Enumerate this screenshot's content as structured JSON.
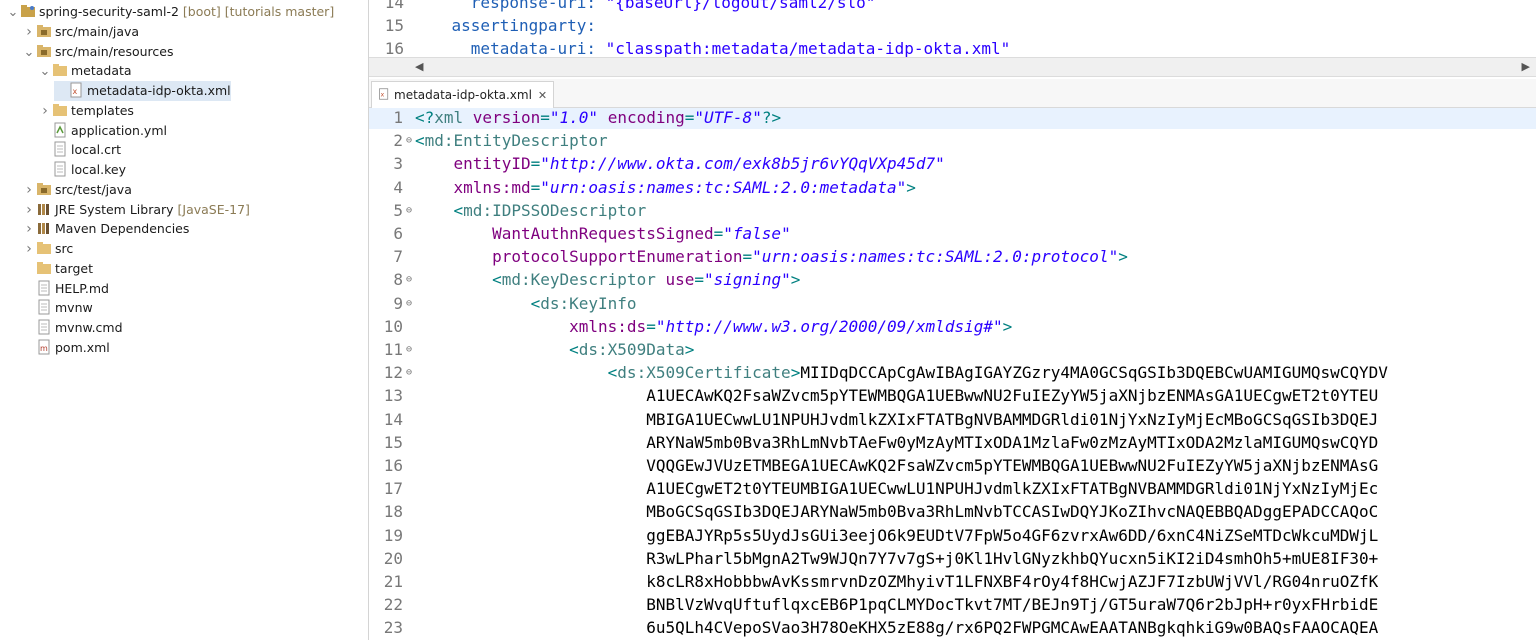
{
  "explorer": {
    "items": [
      {
        "label": "spring-security-saml-2",
        "deco": " [boot] [tutorials master]",
        "indent": 0,
        "twisty": "v",
        "icon": "project-icon"
      },
      {
        "label": "src/main/java",
        "deco": "",
        "indent": 1,
        "twisty": ">",
        "icon": "source-folder-icon"
      },
      {
        "label": "src/main/resources",
        "deco": "",
        "indent": 1,
        "twisty": "v",
        "icon": "source-folder-icon"
      },
      {
        "label": "metadata",
        "deco": "",
        "indent": 2,
        "twisty": "v",
        "icon": "folder-icon"
      },
      {
        "label": "metadata-idp-okta.xml",
        "deco": "",
        "indent": 3,
        "twisty": "",
        "icon": "xml-file-icon"
      },
      {
        "label": "templates",
        "deco": "",
        "indent": 2,
        "twisty": ">",
        "icon": "folder-icon"
      },
      {
        "label": "application.yml",
        "deco": "",
        "indent": 2,
        "twisty": "",
        "icon": "yml-file-icon"
      },
      {
        "label": "local.crt",
        "deco": "",
        "indent": 2,
        "twisty": "",
        "icon": "file-icon"
      },
      {
        "label": "local.key",
        "deco": "",
        "indent": 2,
        "twisty": "",
        "icon": "file-icon"
      },
      {
        "label": "src/test/java",
        "deco": "",
        "indent": 1,
        "twisty": ">",
        "icon": "source-folder-icon"
      },
      {
        "label": "JRE System Library",
        "deco": " [JavaSE-17]",
        "indent": 1,
        "twisty": ">",
        "icon": "library-icon"
      },
      {
        "label": "Maven Dependencies",
        "deco": "",
        "indent": 1,
        "twisty": ">",
        "icon": "library-icon"
      },
      {
        "label": "src",
        "deco": "",
        "indent": 1,
        "twisty": ">",
        "icon": "folder-icon"
      },
      {
        "label": "target",
        "deco": "",
        "indent": 1,
        "twisty": "",
        "icon": "folder-icon"
      },
      {
        "label": "HELP.md",
        "deco": "",
        "indent": 1,
        "twisty": "",
        "icon": "file-icon"
      },
      {
        "label": "mvnw",
        "deco": "",
        "indent": 1,
        "twisty": "",
        "icon": "file-icon"
      },
      {
        "label": "mvnw.cmd",
        "deco": "",
        "indent": 1,
        "twisty": "",
        "icon": "file-icon"
      },
      {
        "label": "pom.xml",
        "deco": "",
        "indent": 1,
        "twisty": "",
        "icon": "maven-file-icon"
      }
    ]
  },
  "top_editor": {
    "lines": [
      {
        "num": "14",
        "text": "      response-uri: \"{baseUrl}/logout/saml2/slo\""
      },
      {
        "num": "15",
        "text": "    assertingparty:"
      },
      {
        "num": "16",
        "text": "      metadata-uri: \"classpath:metadata/metadata-idp-okta.xml\""
      }
    ]
  },
  "tab": {
    "label": "metadata-idp-okta.xml",
    "close": "✕"
  },
  "editor": {
    "lines": [
      {
        "num": "1",
        "fold": "",
        "parts": [
          [
            "pun",
            "<?"
          ],
          [
            "tag",
            "xml "
          ],
          [
            "attr",
            "version"
          ],
          [
            "pun",
            "="
          ],
          [
            "val",
            "\"1.0\""
          ],
          [
            "text",
            " "
          ],
          [
            "attr",
            "encoding"
          ],
          [
            "pun",
            "="
          ],
          [
            "val",
            "\"UTF-8\""
          ],
          [
            "pun",
            "?>"
          ]
        ]
      },
      {
        "num": "2",
        "fold": "⊖",
        "parts": [
          [
            "pun",
            "<"
          ],
          [
            "tag",
            "md:EntityDescriptor"
          ]
        ]
      },
      {
        "num": "3",
        "fold": "",
        "parts": [
          [
            "text",
            "    "
          ],
          [
            "attr",
            "entityID"
          ],
          [
            "pun",
            "="
          ],
          [
            "val",
            "\"http://www.okta.com/exk8b5jr6vYQqVXp45d7\""
          ]
        ]
      },
      {
        "num": "4",
        "fold": "",
        "parts": [
          [
            "text",
            "    "
          ],
          [
            "attr",
            "xmlns:md"
          ],
          [
            "pun",
            "="
          ],
          [
            "val",
            "\"urn:oasis:names:tc:SAML:2.0:metadata\""
          ],
          [
            "pun",
            ">"
          ]
        ]
      },
      {
        "num": "5",
        "fold": "⊖",
        "parts": [
          [
            "text",
            "    "
          ],
          [
            "pun",
            "<"
          ],
          [
            "tag",
            "md:IDPSSODescriptor"
          ]
        ]
      },
      {
        "num": "6",
        "fold": "",
        "parts": [
          [
            "text",
            "        "
          ],
          [
            "attr",
            "WantAuthnRequestsSigned"
          ],
          [
            "pun",
            "="
          ],
          [
            "val",
            "\"false\""
          ]
        ]
      },
      {
        "num": "7",
        "fold": "",
        "parts": [
          [
            "text",
            "        "
          ],
          [
            "attr",
            "protocolSupportEnumeration"
          ],
          [
            "pun",
            "="
          ],
          [
            "val",
            "\"urn:oasis:names:tc:SAML:2.0:protocol\""
          ],
          [
            "pun",
            ">"
          ]
        ]
      },
      {
        "num": "8",
        "fold": "⊖",
        "parts": [
          [
            "text",
            "        "
          ],
          [
            "pun",
            "<"
          ],
          [
            "tag",
            "md:KeyDescriptor "
          ],
          [
            "attr",
            "use"
          ],
          [
            "pun",
            "="
          ],
          [
            "val",
            "\"signing\""
          ],
          [
            "pun",
            ">"
          ]
        ]
      },
      {
        "num": "9",
        "fold": "⊖",
        "parts": [
          [
            "text",
            "            "
          ],
          [
            "pun",
            "<"
          ],
          [
            "tag",
            "ds:KeyInfo"
          ]
        ]
      },
      {
        "num": "10",
        "fold": "",
        "parts": [
          [
            "text",
            "                "
          ],
          [
            "attr",
            "xmlns:ds"
          ],
          [
            "pun",
            "="
          ],
          [
            "val",
            "\"http://www.w3.org/2000/09/xmldsig#\""
          ],
          [
            "pun",
            ">"
          ]
        ]
      },
      {
        "num": "11",
        "fold": "⊖",
        "parts": [
          [
            "text",
            "                "
          ],
          [
            "pun",
            "<"
          ],
          [
            "tag",
            "ds:X509Data"
          ],
          [
            "pun",
            ">"
          ]
        ]
      },
      {
        "num": "12",
        "fold": "⊖",
        "parts": [
          [
            "text",
            "                    "
          ],
          [
            "pun",
            "<"
          ],
          [
            "tag",
            "ds:X509Certificate"
          ],
          [
            "pun",
            ">"
          ],
          [
            "text",
            "MIIDqDCCApCgAwIBAgIGAYZGzry4MA0GCSqGSIb3DQEBCwUAMIGUMQswCQYDV"
          ]
        ]
      },
      {
        "num": "13",
        "fold": "",
        "parts": [
          [
            "text",
            "                        A1UECAwKQ2FsaWZvcm5pYTEWMBQGA1UEBwwNU2FuIEZyYW5jaXNjbzENMAsGA1UECgwET2t0YTEU"
          ]
        ]
      },
      {
        "num": "14",
        "fold": "",
        "parts": [
          [
            "text",
            "                        MBIGA1UECwwLU1NPUHJvdmlkZXIxFTATBgNVBAMMDGRldi01NjYxNzIyMjEcMBoGCSqGSIb3DQEJ"
          ]
        ]
      },
      {
        "num": "15",
        "fold": "",
        "parts": [
          [
            "text",
            "                        ARYNaW5mb0Bva3RhLmNvbTAeFw0yMzAyMTIxODA1MzlaFw0zMzAyMTIxODA2MzlaMIGUMQswCQYD"
          ]
        ]
      },
      {
        "num": "16",
        "fold": "",
        "parts": [
          [
            "text",
            "                        VQQGEwJVUzETMBEGA1UECAwKQ2FsaWZvcm5pYTEWMBQGA1UEBwwNU2FuIEZyYW5jaXNjbzENMAsG"
          ]
        ]
      },
      {
        "num": "17",
        "fold": "",
        "parts": [
          [
            "text",
            "                        A1UECgwET2t0YTEUMBIGA1UECwwLU1NPUHJvdmlkZXIxFTATBgNVBAMMDGRldi01NjYxNzIyMjEc"
          ]
        ]
      },
      {
        "num": "18",
        "fold": "",
        "parts": [
          [
            "text",
            "                        MBoGCSqGSIb3DQEJARYNaW5mb0Bva3RhLmNvbTCCASIwDQYJKoZIhvcNAQEBBQADggEPADCCAQoC"
          ]
        ]
      },
      {
        "num": "19",
        "fold": "",
        "parts": [
          [
            "text",
            "                        ggEBAJYRp5s5UydJsGUi3eejO6k9EUDtV7FpW5o4GF6zvrxAw6DD/6xnC4NiZSeMTDcWkcuMDWjL"
          ]
        ]
      },
      {
        "num": "20",
        "fold": "",
        "parts": [
          [
            "text",
            "                        R3wLPharl5bMgnA2Tw9WJQn7Y7v7gS+j0Kl1HvlGNyzkhbQYucxn5iKI2iD4smhOh5+mUE8IF30+"
          ]
        ]
      },
      {
        "num": "21",
        "fold": "",
        "parts": [
          [
            "text",
            "                        k8cLR8xHobbbwAvKssmrvnDzOZMhyivT1LFNXBF4rOy4f8HCwjAZJF7IzbUWjVVl/RG04nruOZfK"
          ]
        ]
      },
      {
        "num": "22",
        "fold": "",
        "parts": [
          [
            "text",
            "                        BNBlVzWvqUftuflqxcEB6P1pqCLMYDocTkvt7MT/BEJn9Tj/GT5uraW7Q6r2bJpH+r0yxFHrbidE"
          ]
        ]
      },
      {
        "num": "23",
        "fold": "",
        "parts": [
          [
            "text",
            "                        6u5QLh4CVepoSVao3H78OeKHX5zE88g/rx6PQ2FWPGMCAwEAATANBgkqhkiG9w0BAQsFAAOCAQEA"
          ]
        ]
      }
    ]
  },
  "colors": {
    "selection": "#dde8f4",
    "current_line": "#e8f2fe",
    "tag": "#3f7f7f",
    "attr": "#7f007f",
    "value": "#2a00ff"
  }
}
